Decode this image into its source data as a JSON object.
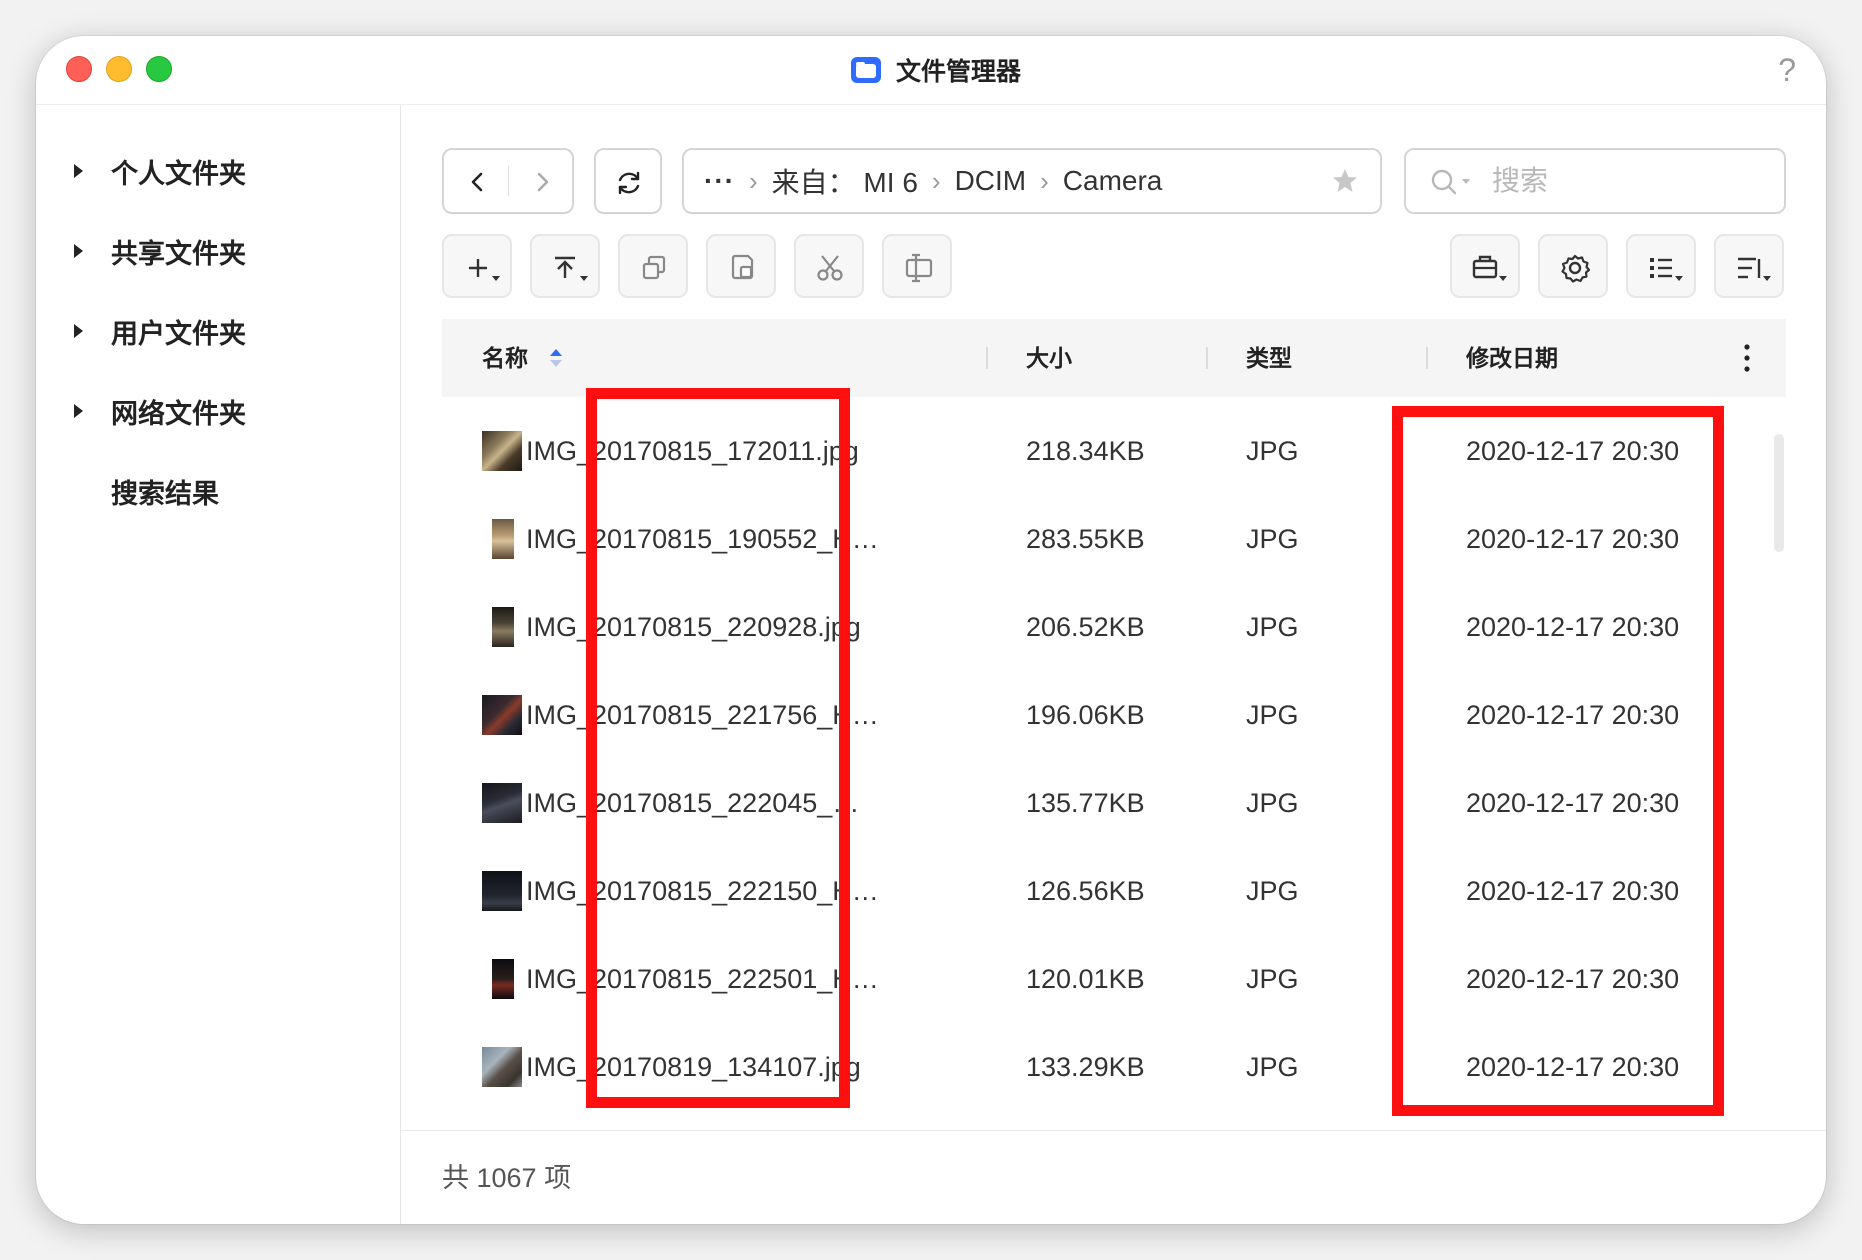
{
  "window": {
    "title": "文件管理器",
    "help_label": "?"
  },
  "sidebar": {
    "items": [
      {
        "label": "个人文件夹",
        "expandable": true
      },
      {
        "label": "共享文件夹",
        "expandable": true
      },
      {
        "label": "用户文件夹",
        "expandable": true
      },
      {
        "label": "网络文件夹",
        "expandable": true
      },
      {
        "label": "搜索结果",
        "expandable": false
      }
    ]
  },
  "pathbar": {
    "more": "···",
    "segments": [
      "来自： MI 6",
      "DCIM",
      "Camera"
    ]
  },
  "search": {
    "placeholder": "搜索"
  },
  "toolbar": {
    "left_icons": [
      "plus-icon",
      "upload-icon",
      "copy-icon",
      "paste-icon",
      "scissors-icon",
      "rename-icon"
    ],
    "right_icons": [
      "toolbox-icon",
      "gear-icon",
      "list-view-icon",
      "sort-icon"
    ]
  },
  "table": {
    "columns": {
      "name": "名称",
      "size": "大小",
      "type": "类型",
      "modified": "修改日期"
    },
    "sort_column": "名称",
    "rows": [
      {
        "name": "IMG_20170815_172011.jpg",
        "size": "218.34KB",
        "type": "JPG",
        "modified": "2020-12-17 20:30"
      },
      {
        "name": "IMG_20170815_190552_H…",
        "size": "283.55KB",
        "type": "JPG",
        "modified": "2020-12-17 20:30"
      },
      {
        "name": "IMG_20170815_220928.jpg",
        "size": "206.52KB",
        "type": "JPG",
        "modified": "2020-12-17 20:30"
      },
      {
        "name": "IMG_20170815_221756_H…",
        "size": "196.06KB",
        "type": "JPG",
        "modified": "2020-12-17 20:30"
      },
      {
        "name": "IMG_20170815_222045_…",
        "size": "135.77KB",
        "type": "JPG",
        "modified": "2020-12-17 20:30"
      },
      {
        "name": "IMG_20170815_222150_H…",
        "size": "126.56KB",
        "type": "JPG",
        "modified": "2020-12-17 20:30"
      },
      {
        "name": "IMG_20170815_222501_H…",
        "size": "120.01KB",
        "type": "JPG",
        "modified": "2020-12-17 20:30"
      },
      {
        "name": "IMG_20170819_134107.jpg",
        "size": "133.29KB",
        "type": "JPG",
        "modified": "2020-12-17 20:30"
      }
    ]
  },
  "footer": {
    "count": "共 1067 项"
  },
  "colors": {
    "annotation": "#ff1010",
    "accent": "#2f6bff"
  }
}
